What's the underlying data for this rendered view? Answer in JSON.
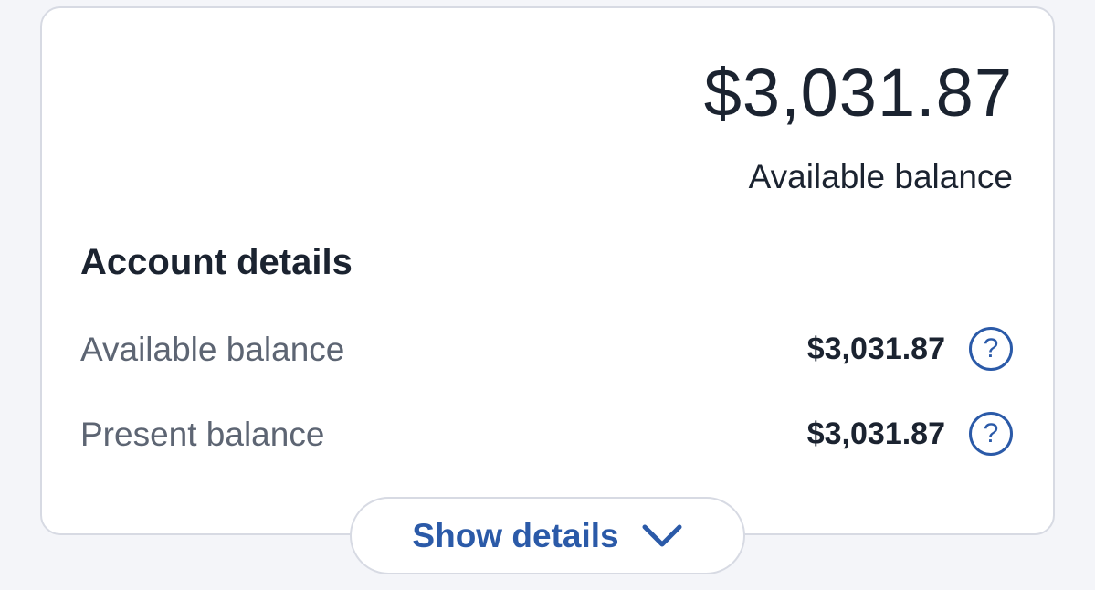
{
  "balance_card": {
    "hero_amount": "$3,031.87",
    "hero_label": "Available balance"
  },
  "account_details": {
    "title": "Account details",
    "rows": [
      {
        "label": "Available balance",
        "value": "$3,031.87",
        "help_icon": "?"
      },
      {
        "label": "Present balance",
        "value": "$3,031.87",
        "help_icon": "?"
      }
    ]
  },
  "show_details": {
    "label": "Show details",
    "icon": "chevron-down-icon"
  },
  "colors": {
    "background": "#f4f5f9",
    "card": "#ffffff",
    "border": "#d7dae3",
    "text_primary": "#1b2330",
    "text_secondary": "#5d6573",
    "accent": "#2b5aa8"
  }
}
